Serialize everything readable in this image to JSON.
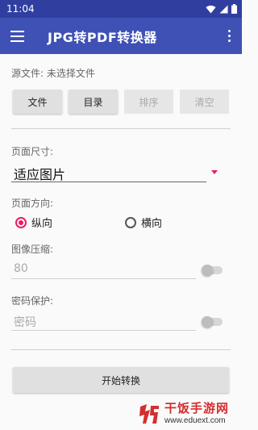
{
  "status_bar": {
    "time": "11:04"
  },
  "app_bar": {
    "title": "JPG转PDF转换器"
  },
  "source": {
    "label": "源文件: 未选择文件",
    "buttons": [
      {
        "label": "文件",
        "enabled": true
      },
      {
        "label": "目录",
        "enabled": true
      },
      {
        "label": "排序",
        "enabled": false
      },
      {
        "label": "清空",
        "enabled": false
      }
    ]
  },
  "page_size": {
    "label": "页面尺寸:",
    "value": "适应图片"
  },
  "orientation": {
    "label": "页面方向:",
    "options": [
      {
        "label": "纵向",
        "checked": true
      },
      {
        "label": "横向",
        "checked": false
      }
    ]
  },
  "compression": {
    "label": "图像压缩:",
    "value": "80",
    "enabled": false
  },
  "password": {
    "label": "密码保护:",
    "placeholder": "密码",
    "enabled": false
  },
  "start_button": {
    "label": "开始转换"
  },
  "watermark": {
    "title": "干饭手游网",
    "url": "www.eduext.com"
  },
  "colors": {
    "primary": "#3f51b5",
    "primary_dark": "#303f9f",
    "accent": "#e91e63"
  }
}
